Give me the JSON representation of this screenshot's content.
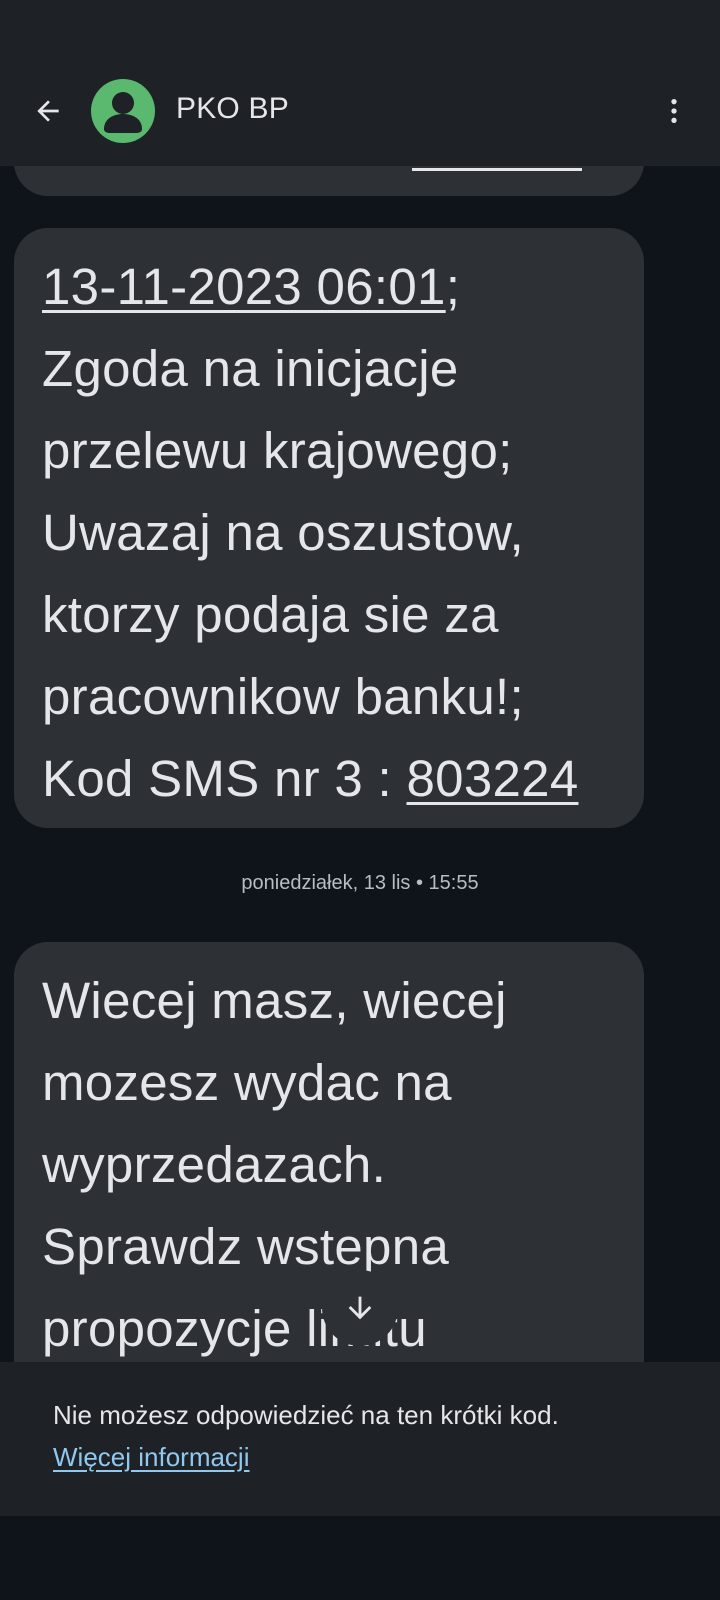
{
  "header": {
    "contact_name": "PKO BP",
    "back_icon": "arrow-back-icon",
    "avatar_icon": "person-icon",
    "menu_icon": "more-vert-icon",
    "avatar_color": "#5ab96f"
  },
  "messages": [
    {
      "date_link": "13-11-2023 06:01",
      "date_suffix": ";",
      "lines": [
        "Zgoda na inicjacje",
        "przelewu krajowego;",
        "Uwazaj na oszustow,",
        "ktorzy podaja sie za",
        "pracownikow banku!;"
      ],
      "code_prefix": "Kod SMS nr 3 : ",
      "code": "803224"
    },
    {
      "lines": [
        "Wiecej masz, wiecej",
        "mozesz wydac na",
        "wyprzedazach.",
        "Sprawdz wstepna",
        "propozycje limitu"
      ]
    }
  ],
  "timestamp": "poniedziałek, 13 lis • 15:55",
  "scroll_icon": "arrow-down-icon",
  "notice": {
    "text": "Nie możesz odpowiedzieć na ten krótki kod.",
    "link": "Więcej informacji"
  },
  "colors": {
    "background": "#0f141b",
    "bubble": "#2d3136",
    "bar": "#1e2125",
    "link": "#8fc9f0"
  }
}
